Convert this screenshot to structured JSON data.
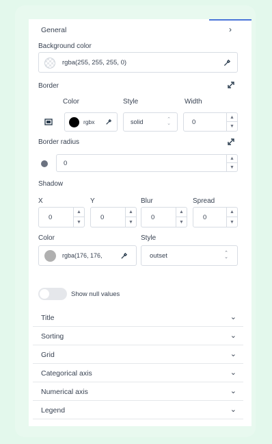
{
  "general": {
    "title": "General"
  },
  "background": {
    "label": "Background color",
    "value": "rgba(255, 255, 255, 0)"
  },
  "border": {
    "label": "Border",
    "color_label": "Color",
    "style_label": "Style",
    "width_label": "Width",
    "color_value": "rgbx",
    "style_value": "solid",
    "width_value": "0"
  },
  "radius": {
    "label": "Border radius",
    "value": "0"
  },
  "shadow": {
    "label": "Shadow",
    "x_label": "X",
    "y_label": "Y",
    "blur_label": "Blur",
    "spread_label": "Spread",
    "x_value": "0",
    "y_value": "0",
    "blur_value": "0",
    "spread_value": "0",
    "color_label": "Color",
    "style_label": "Style",
    "color_value": "rgba(176, 176,",
    "style_value": "outset"
  },
  "toggle": {
    "label": "Show null values",
    "on": false
  },
  "sections": [
    "Title",
    "Sorting",
    "Grid",
    "Categorical axis",
    "Numerical axis",
    "Legend"
  ],
  "colors": {
    "accent": "#4a74d9",
    "swatch_gray": "#b0b0b0",
    "background": "#e3f8ec"
  }
}
